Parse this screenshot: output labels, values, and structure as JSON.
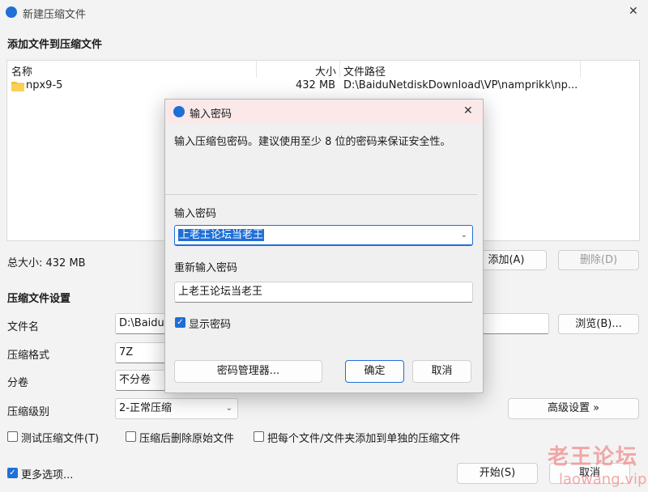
{
  "window": {
    "title": "新建压缩文件",
    "close_glyph": "✕"
  },
  "add_section": {
    "heading": "添加文件到压缩文件",
    "columns": {
      "name": "名称",
      "size": "大小",
      "path": "文件路径"
    },
    "rows": [
      {
        "name": "npx9-5",
        "size": "432 MB",
        "path": "D:\\BaiduNetdiskDownload\\VP\\namprikk\\np..."
      }
    ],
    "total_size": "总大小: 432 MB",
    "add_button": "添加(A)",
    "delete_button": "删除(D)"
  },
  "settings": {
    "heading": "压缩文件设置",
    "filename_label": "文件名",
    "filename_value": "D:\\Baidu",
    "browse_button": "浏览(B)...",
    "format_label": "压缩格式",
    "format_value": "7Z",
    "volume_label": "分卷",
    "volume_value": "不分卷",
    "level_label": "压缩级别",
    "level_value": "2-正常压缩",
    "advanced_button": "高级设置 »",
    "opt_test": "测试压缩文件(T)",
    "opt_delete": "压缩后删除原始文件",
    "opt_each": "把每个文件/文件夹添加到单独的压缩文件"
  },
  "footer": {
    "more_options": "更多选项...",
    "start_button": "开始(S)",
    "cancel_button": "取消"
  },
  "dialog": {
    "title": "输入密码",
    "close_glyph": "✕",
    "description": "输入压缩包密码。建议使用至少 8 位的密码来保证安全性。",
    "password_label": "输入密码",
    "password_value": "上老王论坛当老王",
    "reenter_label": "重新输入密码",
    "reenter_value": "上老王论坛当老王",
    "show_password": "显示密码",
    "manager_button": "密码管理器...",
    "ok_button": "确定",
    "cancel_button": "取消"
  },
  "watermark": {
    "line1": "老王论坛",
    "line2": "laowang.vip"
  },
  "colors": {
    "accent": "#1f6fd6",
    "dialog_titlebar": "#fbe9ea",
    "folder": "#f3c23c"
  }
}
